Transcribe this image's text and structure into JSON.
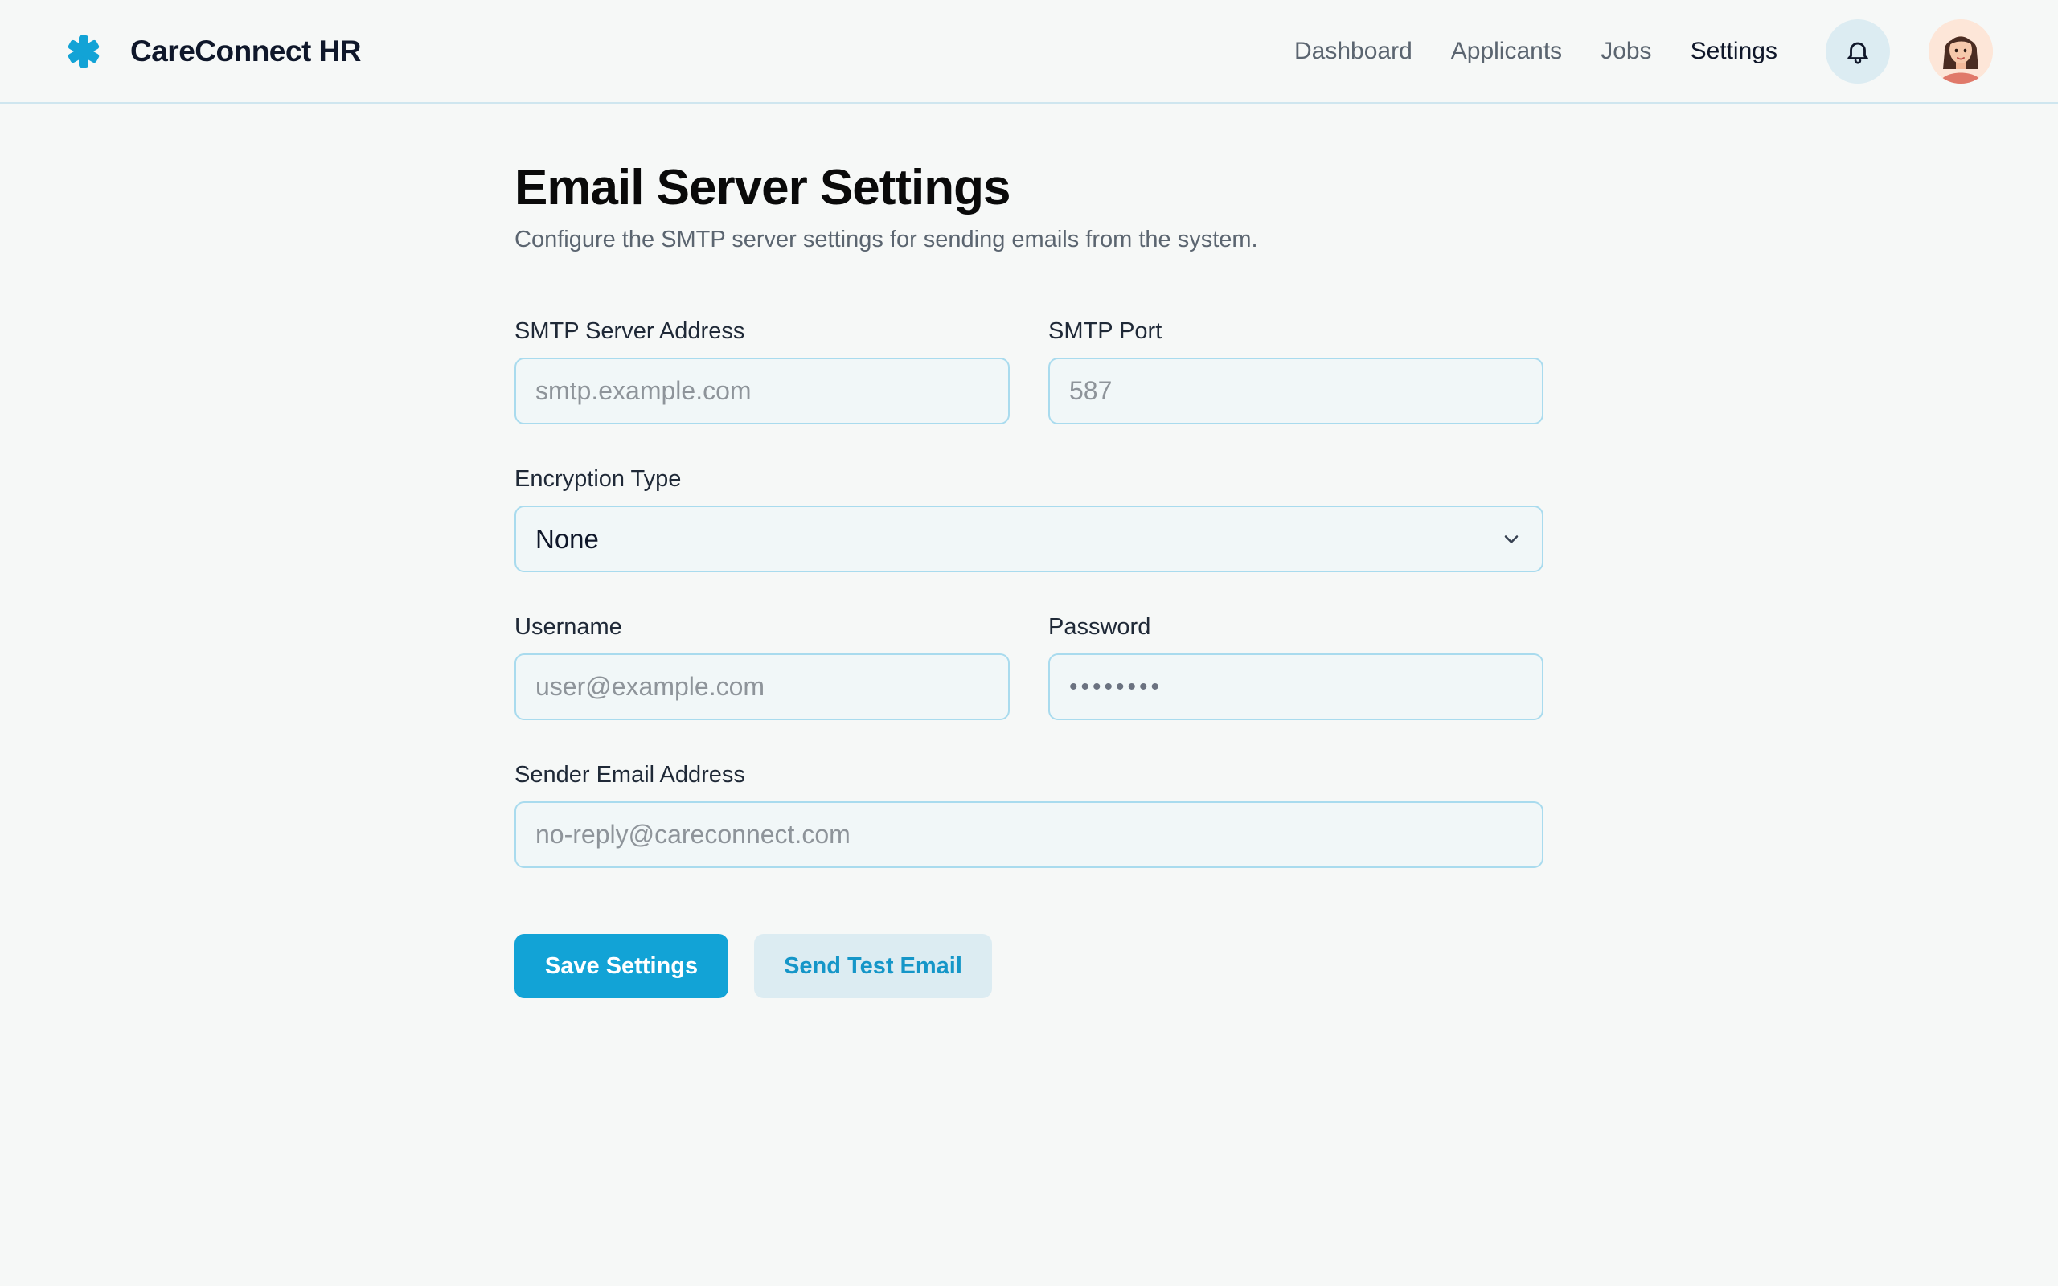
{
  "app": {
    "name": "CareConnect HR",
    "brand_color": "#12a3d6"
  },
  "nav": {
    "items": [
      {
        "label": "Dashboard",
        "active": false
      },
      {
        "label": "Applicants",
        "active": false
      },
      {
        "label": "Jobs",
        "active": false
      },
      {
        "label": "Settings",
        "active": true
      }
    ],
    "notification_icon": "bell-icon",
    "avatar_icon": "user-avatar"
  },
  "page": {
    "title": "Email Server Settings",
    "subtitle": "Configure the SMTP server settings for sending emails from the system."
  },
  "form": {
    "smtp_server": {
      "label": "SMTP Server Address",
      "value": "",
      "placeholder": "smtp.example.com"
    },
    "smtp_port": {
      "label": "SMTP Port",
      "value": "",
      "placeholder": "587"
    },
    "encryption": {
      "label": "Encryption Type",
      "selected": "None",
      "icon": "chevron-down-icon"
    },
    "username": {
      "label": "Username",
      "value": "",
      "placeholder": "user@example.com"
    },
    "password": {
      "label": "Password",
      "masked_value": "••••••••"
    },
    "sender_email": {
      "label": "Sender Email Address",
      "value": "",
      "placeholder": "no-reply@careconnect.com"
    }
  },
  "actions": {
    "save_label": "Save Settings",
    "test_label": "Send Test Email"
  }
}
